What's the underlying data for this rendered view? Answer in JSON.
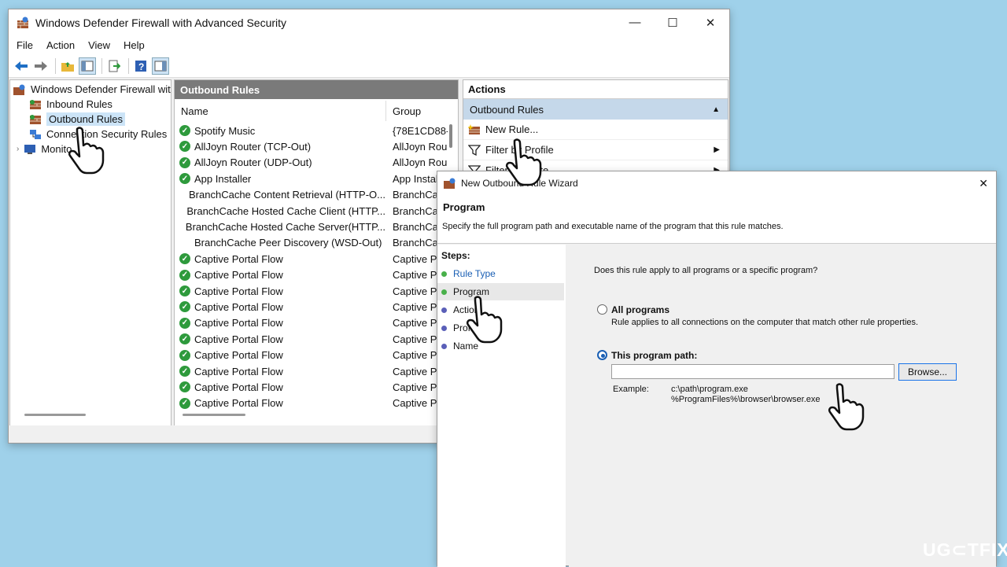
{
  "main_window": {
    "title": "Windows Defender Firewall with Advanced Security",
    "controls": {
      "minimize": "—",
      "maximize": "☐",
      "close": "✕"
    },
    "menu": [
      "File",
      "Action",
      "View",
      "Help"
    ],
    "tree": {
      "root": "Windows Defender Firewall with",
      "items": [
        "Inbound Rules",
        "Outbound Rules",
        "Connection Security Rules",
        "Monito"
      ]
    },
    "middle": {
      "header": "Outbound Rules",
      "col_name": "Name",
      "col_group": "Group",
      "rows": [
        {
          "name": "Spotify Music",
          "group": "{78E1CD88-",
          "enabled": true
        },
        {
          "name": "AllJoyn Router (TCP-Out)",
          "group": "AllJoyn Rou",
          "enabled": true
        },
        {
          "name": "AllJoyn Router (UDP-Out)",
          "group": "AllJoyn Rou",
          "enabled": true
        },
        {
          "name": "App Installer",
          "group": "App Instal",
          "enabled": true
        },
        {
          "name": "BranchCache Content Retrieval (HTTP-O...",
          "group": "BranchCac",
          "enabled": false
        },
        {
          "name": "BranchCache Hosted Cache Client (HTTP...",
          "group": "BranchCac",
          "enabled": false
        },
        {
          "name": "BranchCache Hosted Cache Server(HTTP...",
          "group": "BranchCac",
          "enabled": false
        },
        {
          "name": "BranchCache Peer Discovery (WSD-Out)",
          "group": "BranchCac",
          "enabled": false
        },
        {
          "name": "Captive Portal Flow",
          "group": "Captive Po",
          "enabled": true
        },
        {
          "name": "Captive Portal Flow",
          "group": "Captive Po",
          "enabled": true
        },
        {
          "name": "Captive Portal Flow",
          "group": "Captive Po",
          "enabled": true
        },
        {
          "name": "Captive Portal Flow",
          "group": "Captive Po",
          "enabled": true
        },
        {
          "name": "Captive Portal Flow",
          "group": "Captive Po",
          "enabled": true
        },
        {
          "name": "Captive Portal Flow",
          "group": "Captive Po",
          "enabled": true
        },
        {
          "name": "Captive Portal Flow",
          "group": "Captive Po",
          "enabled": true
        },
        {
          "name": "Captive Portal Flow",
          "group": "Captive Po",
          "enabled": true
        },
        {
          "name": "Captive Portal Flow",
          "group": "Captive Po",
          "enabled": true
        },
        {
          "name": "Captive Portal Flow",
          "group": "Captive Po",
          "enabled": true
        }
      ]
    },
    "actions": {
      "header": "Actions",
      "section": "Outbound Rules",
      "items": [
        "New Rule...",
        "Filter by Profile",
        "Filter by State"
      ]
    }
  },
  "wizard": {
    "title": "New Outbound Rule Wizard",
    "close": "✕",
    "heading": "Program",
    "subheading": "Specify the full program path and executable name of the program that this rule matches.",
    "steps_label": "Steps:",
    "steps": [
      "Rule Type",
      "Program",
      "Action",
      "Profile",
      "Name"
    ],
    "question": "Does this rule apply to all programs or a specific program?",
    "option_all": {
      "label": "All programs",
      "desc": "Rule applies to all connections on the computer that match other rule properties.",
      "selected": false
    },
    "option_path": {
      "label": "This program path:",
      "selected": true,
      "value": ""
    },
    "browse": "Browse...",
    "example_label": "Example:",
    "example_1": "c:\\path\\program.exe",
    "example_2": "%ProgramFiles%\\browser\\browser.exe"
  },
  "watermark": "UG⊂TFIX"
}
